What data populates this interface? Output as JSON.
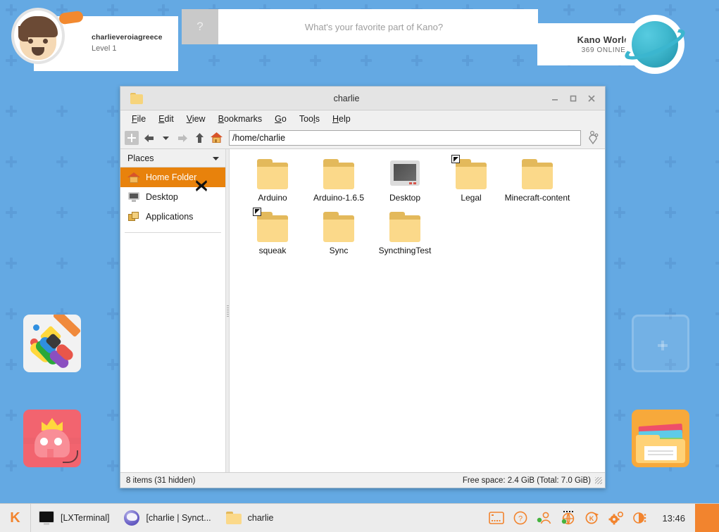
{
  "desktop": {
    "background_color": "#64a9e3",
    "plus_color": "#5c9dd8",
    "icons": [
      {
        "name": "paint-app",
        "label": ""
      },
      {
        "name": "snake-app",
        "label": ""
      },
      {
        "name": "empty-slot",
        "label": ""
      },
      {
        "name": "files-app",
        "label": ""
      }
    ]
  },
  "topbar": {
    "profile": {
      "username": "charlieveroiagreece",
      "level": "Level 1"
    },
    "question": {
      "icon_label": "?",
      "prompt": "What's your favorite part of Kano?"
    },
    "kano_world": {
      "title": "Kano World",
      "online": "369 ONLINE"
    }
  },
  "file_manager": {
    "title": "charlie",
    "window_buttons": {
      "minimize": "minimize",
      "maximize": "maximize",
      "close": "close"
    },
    "menu": [
      {
        "accel": "F",
        "rest": "ile"
      },
      {
        "accel": "E",
        "rest": "dit"
      },
      {
        "accel": "V",
        "rest": "iew"
      },
      {
        "accel": "B",
        "rest": "ookmarks"
      },
      {
        "accel": "G",
        "rest": "o"
      },
      {
        "accel": "T",
        "rest": "ools"
      },
      {
        "accel": "H",
        "rest": "elp"
      }
    ],
    "menu_labels": [
      "File",
      "Edit",
      "View",
      "Bookmarks",
      "Go",
      "Tools",
      "Help"
    ],
    "toolbar": {
      "new_tab": "new-tab-button",
      "back": "back-button",
      "history_dropdown": "history-dropdown-button",
      "forward": "forward-button",
      "up": "up-button",
      "home": "home-button",
      "view_options": "view-options-button"
    },
    "path": "/home/charlie",
    "sidebar": {
      "header": "Places",
      "items": [
        {
          "label": "Home Folder",
          "icon": "home-icon",
          "active": true
        },
        {
          "label": "Desktop",
          "icon": "monitor-icon",
          "active": false
        },
        {
          "label": "Applications",
          "icon": "applications-icon",
          "active": false
        }
      ]
    },
    "files": [
      {
        "label": "Arduino",
        "type": "folder",
        "symlink": false
      },
      {
        "label": "Arduino-1.6.5",
        "type": "folder",
        "symlink": false
      },
      {
        "label": "Desktop",
        "type": "desktop",
        "symlink": false
      },
      {
        "label": "Legal",
        "type": "folder",
        "symlink": true
      },
      {
        "label": "Minecraft-content",
        "type": "folder",
        "symlink": false
      },
      {
        "label": "squeak",
        "type": "folder",
        "symlink": true
      },
      {
        "label": "Sync",
        "type": "folder",
        "symlink": false
      },
      {
        "label": "SyncthingTest",
        "type": "folder",
        "symlink": false
      }
    ],
    "status": {
      "items": "8 items (31 hidden)",
      "free_space": "Free space: 2.4 GiB (Total: 7.0 GiB)"
    },
    "selection_color": "#e8820c"
  },
  "taskbar": {
    "start_label": "K",
    "tasks": [
      {
        "label": "[LXTerminal]",
        "icon": "terminal-icon"
      },
      {
        "label": "[charlie | Synct...",
        "icon": "syncthing-icon"
      },
      {
        "label": "charlie",
        "icon": "folder-icon"
      }
    ],
    "tray": [
      {
        "name": "terminal-tray-icon"
      },
      {
        "name": "help-tray-icon"
      },
      {
        "name": "user-status-tray-icon"
      },
      {
        "name": "network-tray-icon"
      },
      {
        "name": "kano-updater-tray-icon"
      },
      {
        "name": "settings-tray-icon"
      },
      {
        "name": "brightness-tray-icon"
      }
    ],
    "clock": "13:46",
    "accent_color": "#f2842e"
  }
}
